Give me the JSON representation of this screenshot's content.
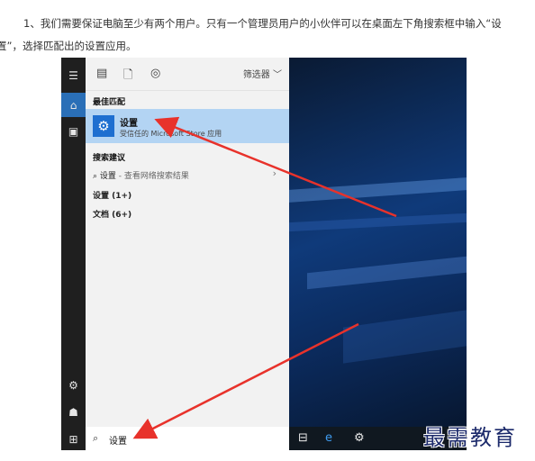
{
  "caption": {
    "line1": "1、我们需要保证电脑至少有两个用户。只有一个管理员用户的小伙伴可以在桌面左下角搜索框中输入“设",
    "line2": "置”，选择匹配出的设置应用。"
  },
  "start_menu": {
    "filter_label": "筛选器 ﹀",
    "best_match_heading": "最佳匹配",
    "best_match": {
      "title": "设置",
      "subtitle": "受信任的 Microsoft Store 应用"
    },
    "web_heading": "搜索建议",
    "web_suggestion": {
      "text": "设置",
      "hint": " - 查看网络搜索结果"
    },
    "groups": [
      {
        "label": "设置 (1+)"
      },
      {
        "label": "文档 (6+)"
      }
    ],
    "search_query": "设置"
  },
  "watermark": "最需教育",
  "colors": {
    "accent": "#1e6fd0",
    "highlight": "#b3d4f3",
    "arrow": "#e8322b"
  }
}
